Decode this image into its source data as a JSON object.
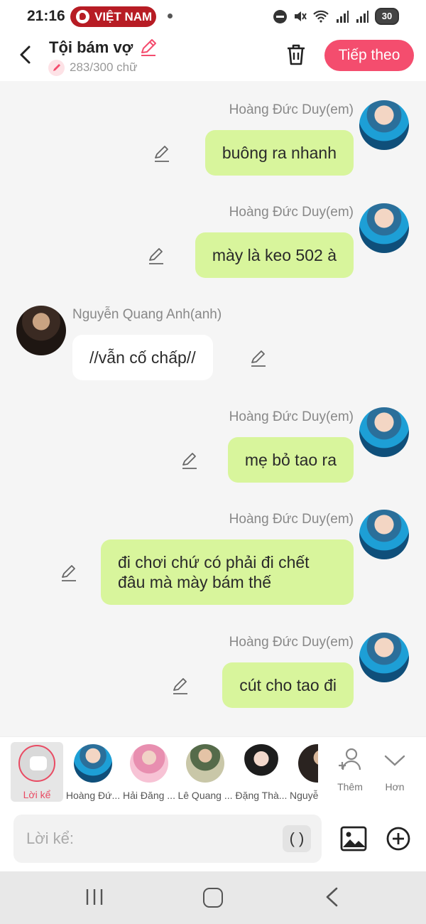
{
  "status_bar": {
    "time": "21:16",
    "carrier_badge": "VIỆT NAM",
    "battery": "30",
    "icons": [
      "dnd-icon",
      "mute-icon",
      "wifi-icon",
      "signal-icon",
      "signal-icon",
      "battery-icon"
    ]
  },
  "header": {
    "title": "Tội bám vợ",
    "char_count": "283/300 chữ",
    "next_label": "Tiếp theo",
    "accent_color": "#f44d6e"
  },
  "messages": [
    {
      "sender": "Hoàng Đức Duy(em)",
      "side": "right",
      "text": "buông ra nhanh"
    },
    {
      "sender": "Hoàng Đức Duy(em)",
      "side": "right",
      "text": "mày là keo 502 à"
    },
    {
      "sender": "Nguyễn Quang Anh(anh)",
      "side": "left",
      "text": "//vẫn cố chấp//"
    },
    {
      "sender": "Hoàng Đức Duy(em)",
      "side": "right",
      "text": "mẹ bỏ tao ra"
    },
    {
      "sender": "Hoàng Đức Duy(em)",
      "side": "right",
      "text": "đi chơi chứ có phải đi chết đâu mà mày bám thế"
    },
    {
      "sender": "Hoàng Đức Duy(em)",
      "side": "right",
      "text": "cút cho tao đi"
    }
  ],
  "characters": {
    "narrator_label": "Lời kể",
    "items": [
      "Hoàng Đứ...",
      "Hải Đăng ...",
      "Lê Quang ...",
      "Đặng Thà...",
      "Nguyễ"
    ],
    "add_label": "Thêm",
    "more_label": "Hơn"
  },
  "composer": {
    "placeholder": "Lời kể:",
    "paren_button": "( )"
  },
  "colors": {
    "my_bubble": "#d8f59c",
    "their_bubble": "#ffffff",
    "chat_bg": "#f5f5f5"
  }
}
